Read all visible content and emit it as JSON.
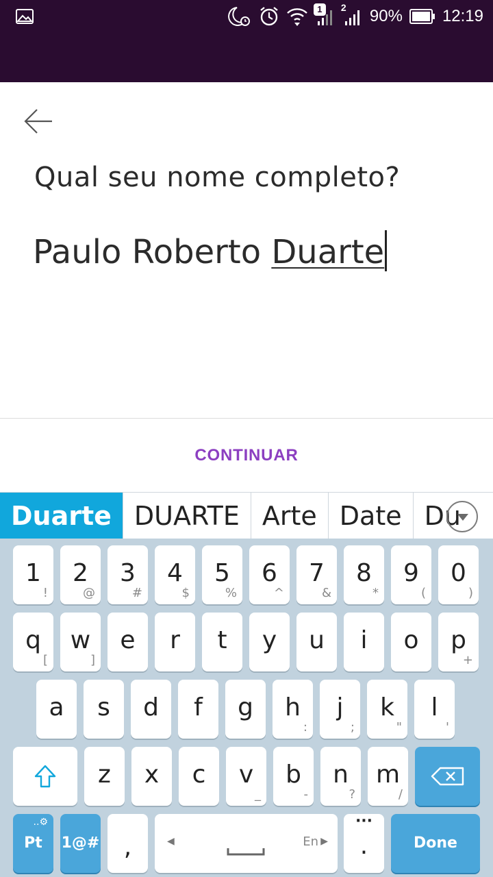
{
  "status_bar": {
    "battery_percent": "90%",
    "time": "12:19",
    "sim1_badge": "1",
    "sim2_badge": "2",
    "colors": {
      "background": "#2a0c30"
    }
  },
  "form": {
    "question": "Qual seu nome completo?",
    "name_committed": "Paulo Roberto ",
    "name_composing": "Duarte",
    "continue_label": "CONTINUAR",
    "colors": {
      "accent": "#8c3fc1"
    }
  },
  "suggestions": {
    "items": [
      "Duarte",
      "DUARTE",
      "Arte",
      "Date",
      "Du"
    ],
    "selected_index": 0,
    "colors": {
      "selected_bg": "#11a7dc"
    }
  },
  "keyboard": {
    "rows": [
      [
        {
          "main": "1",
          "sub": "!"
        },
        {
          "main": "2",
          "sub": "@"
        },
        {
          "main": "3",
          "sub": "#"
        },
        {
          "main": "4",
          "sub": "$"
        },
        {
          "main": "5",
          "sub": "%"
        },
        {
          "main": "6",
          "sub": "^"
        },
        {
          "main": "7",
          "sub": "&"
        },
        {
          "main": "8",
          "sub": "*"
        },
        {
          "main": "9",
          "sub": "("
        },
        {
          "main": "0",
          "sub": ")"
        }
      ],
      [
        {
          "main": "q",
          "sub": "["
        },
        {
          "main": "w",
          "sub": "]"
        },
        {
          "main": "e",
          "sub": ""
        },
        {
          "main": "r",
          "sub": ""
        },
        {
          "main": "t",
          "sub": ""
        },
        {
          "main": "y",
          "sub": ""
        },
        {
          "main": "u",
          "sub": ""
        },
        {
          "main": "i",
          "sub": ""
        },
        {
          "main": "o",
          "sub": ""
        },
        {
          "main": "p",
          "sub": "+"
        }
      ],
      [
        {
          "main": "a",
          "sub": ""
        },
        {
          "main": "s",
          "sub": ""
        },
        {
          "main": "d",
          "sub": ""
        },
        {
          "main": "f",
          "sub": ""
        },
        {
          "main": "g",
          "sub": ""
        },
        {
          "main": "h",
          "sub": ":"
        },
        {
          "main": "j",
          "sub": ";"
        },
        {
          "main": "k",
          "sub": "\""
        },
        {
          "main": "l",
          "sub": "'"
        }
      ],
      [
        {
          "main": "z",
          "sub": ""
        },
        {
          "main": "x",
          "sub": ""
        },
        {
          "main": "c",
          "sub": ""
        },
        {
          "main": "v",
          "sub": "_"
        },
        {
          "main": "b",
          "sub": "-"
        },
        {
          "main": "n",
          "sub": "?"
        },
        {
          "main": "m",
          "sub": "/"
        }
      ]
    ],
    "language_key": "Pt",
    "symbols_key": "1@#",
    "comma_key": ",",
    "space_language_hint": "En",
    "period_key": ".",
    "done_key": "Done",
    "icons": [
      "shift-icon",
      "backspace-icon",
      "space-icon",
      "settings-icon"
    ]
  }
}
